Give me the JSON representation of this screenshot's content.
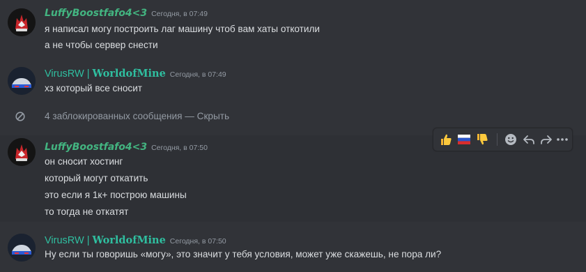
{
  "messages": [
    {
      "author": "LuffyBoostfafo4<3",
      "timestamp": "Сегодня, в 07:49",
      "lines": [
        "я написал могу построить лаг машину чтоб вам хаты откотили",
        "а не чтобы сервер снести"
      ]
    },
    {
      "author_main": "VirusRW",
      "author_sep": " | ",
      "author_tag": "WorldofMine",
      "timestamp": "Сегодня, в 07:49",
      "lines": [
        "хз который все сносит"
      ]
    },
    {
      "author": "LuffyBoostfafo4<3",
      "timestamp": "Сегодня, в 07:50",
      "lines": [
        "он сносит хостинг",
        "который могут откатить",
        "это если я 1к+ построю машины",
        "то тогда не откатят"
      ]
    },
    {
      "author_main": "VirusRW",
      "author_sep": " | ",
      "author_tag": "WorldofMine",
      "timestamp": "Сегодня, в 07:50",
      "lines": [
        "Ну если ты говоришь «могу», это значит у тебя условия, может уже скажешь, не пора ли?"
      ]
    }
  ],
  "blocked": {
    "text": "4 заблокированных сообщения",
    "dash": " — ",
    "hide_label": "Скрыть"
  },
  "toolbar": {
    "reactions": [
      "thumbs-up-emoji",
      "russia-flag-emoji",
      "thumbs-down-emoji"
    ],
    "actions": [
      "add-reaction-icon",
      "reply-icon",
      "forward-icon",
      "more-icon"
    ]
  },
  "colors": {
    "background": "#313338",
    "luffy_name": "#43b581",
    "virus_name": "#2fbfa0",
    "text": "#dbdee1",
    "muted": "#949ba4"
  }
}
